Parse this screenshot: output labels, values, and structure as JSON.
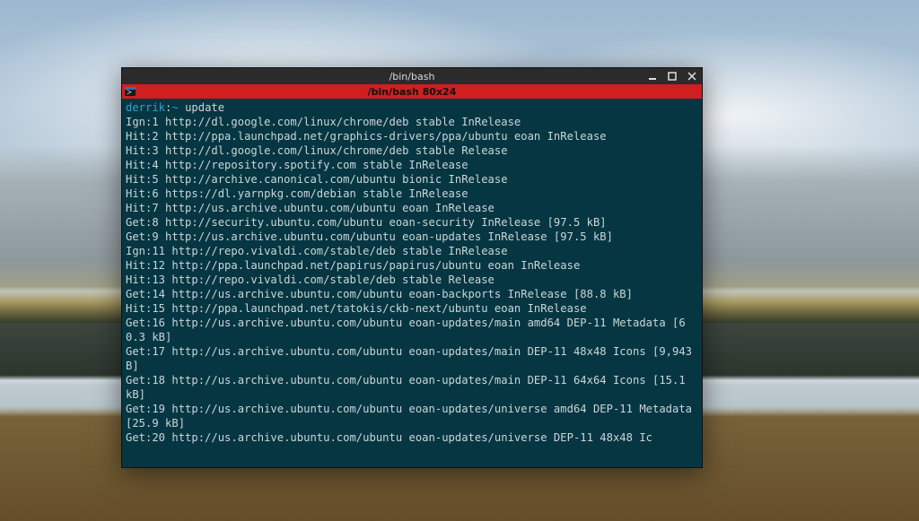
{
  "window": {
    "title_outer": "/bin/bash",
    "title_inner": "/bin/bash 80x24"
  },
  "prompt": {
    "user_host": "derrik",
    "sep": ":",
    "path": "~",
    "sigil": " ",
    "command": "update"
  },
  "output_lines": [
    "Ign:1 http://dl.google.com/linux/chrome/deb stable InRelease",
    "Hit:2 http://ppa.launchpad.net/graphics-drivers/ppa/ubuntu eoan InRelease",
    "Hit:3 http://dl.google.com/linux/chrome/deb stable Release",
    "Hit:4 http://repository.spotify.com stable InRelease",
    "Hit:5 http://archive.canonical.com/ubuntu bionic InRelease",
    "Hit:6 https://dl.yarnpkg.com/debian stable InRelease",
    "Hit:7 http://us.archive.ubuntu.com/ubuntu eoan InRelease",
    "Get:8 http://security.ubuntu.com/ubuntu eoan-security InRelease [97.5 kB]",
    "Get:9 http://us.archive.ubuntu.com/ubuntu eoan-updates InRelease [97.5 kB]",
    "Ign:11 http://repo.vivaldi.com/stable/deb stable InRelease",
    "Hit:12 http://ppa.launchpad.net/papirus/papirus/ubuntu eoan InRelease",
    "Hit:13 http://repo.vivaldi.com/stable/deb stable Release",
    "Get:14 http://us.archive.ubuntu.com/ubuntu eoan-backports InRelease [88.8 kB]",
    "Hit:15 http://ppa.launchpad.net/tatokis/ckb-next/ubuntu eoan InRelease",
    "Get:16 http://us.archive.ubuntu.com/ubuntu eoan-updates/main amd64 DEP-11 Metadata [60.3 kB]",
    "Get:17 http://us.archive.ubuntu.com/ubuntu eoan-updates/main DEP-11 48x48 Icons [9,943 B]",
    "Get:18 http://us.archive.ubuntu.com/ubuntu eoan-updates/main DEP-11 64x64 Icons [15.1 kB]",
    "Get:19 http://us.archive.ubuntu.com/ubuntu eoan-updates/universe amd64 DEP-11 Metadata [25.9 kB]",
    "Get:20 http://us.archive.ubuntu.com/ubuntu eoan-updates/universe DEP-11 48x48 Ic"
  ]
}
